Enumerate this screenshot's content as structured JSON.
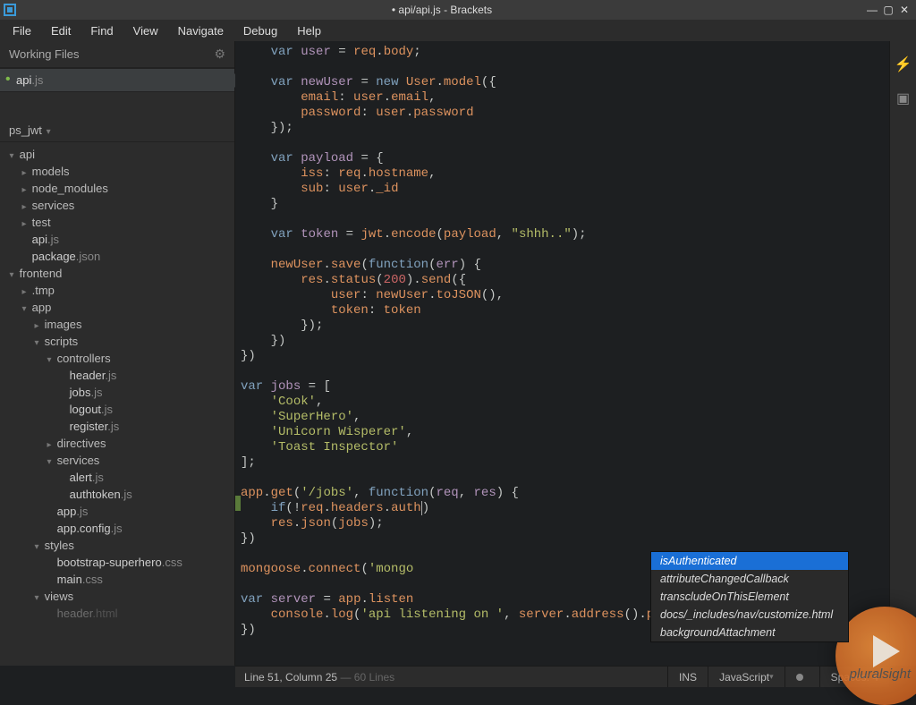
{
  "window": {
    "title": "• api/api.js - Brackets",
    "app_name": "Brackets"
  },
  "menu": [
    "File",
    "Edit",
    "Find",
    "View",
    "Navigate",
    "Debug",
    "Help"
  ],
  "sidebar": {
    "working_files_label": "Working Files",
    "working_files": [
      {
        "name": "api",
        "ext": ".js",
        "dirty": true,
        "active": true
      }
    ],
    "project_root": "ps_jwt",
    "tree": [
      {
        "type": "folder",
        "name": "api",
        "depth": 0,
        "open": true,
        "collapsed": false
      },
      {
        "type": "folder",
        "name": "models",
        "depth": 1,
        "open": false
      },
      {
        "type": "folder",
        "name": "node_modules",
        "depth": 1,
        "open": false
      },
      {
        "type": "folder",
        "name": "services",
        "depth": 1,
        "open": false
      },
      {
        "type": "folder",
        "name": "test",
        "depth": 1,
        "open": false
      },
      {
        "type": "file",
        "name": "api",
        "ext": ".js",
        "depth": 1
      },
      {
        "type": "file",
        "name": "package",
        "ext": ".json",
        "depth": 1
      },
      {
        "type": "folder",
        "name": "frontend",
        "depth": 0,
        "open": true,
        "collapsed": false
      },
      {
        "type": "folder",
        "name": ".tmp",
        "depth": 1,
        "open": false
      },
      {
        "type": "folder",
        "name": "app",
        "depth": 1,
        "open": true,
        "collapsed": false
      },
      {
        "type": "folder",
        "name": "images",
        "depth": 2,
        "open": false
      },
      {
        "type": "folder",
        "name": "scripts",
        "depth": 2,
        "open": true,
        "collapsed": false
      },
      {
        "type": "folder",
        "name": "controllers",
        "depth": 3,
        "open": true,
        "collapsed": false
      },
      {
        "type": "file",
        "name": "header",
        "ext": ".js",
        "depth": 4
      },
      {
        "type": "file",
        "name": "jobs",
        "ext": ".js",
        "depth": 4
      },
      {
        "type": "file",
        "name": "logout",
        "ext": ".js",
        "depth": 4
      },
      {
        "type": "file",
        "name": "register",
        "ext": ".js",
        "depth": 4
      },
      {
        "type": "folder",
        "name": "directives",
        "depth": 3,
        "open": false
      },
      {
        "type": "folder",
        "name": "services",
        "depth": 3,
        "open": true,
        "collapsed": false
      },
      {
        "type": "file",
        "name": "alert",
        "ext": ".js",
        "depth": 4
      },
      {
        "type": "file",
        "name": "authtoken",
        "ext": ".js",
        "depth": 4
      },
      {
        "type": "file",
        "name": "app",
        "ext": ".js",
        "depth": 3
      },
      {
        "type": "file",
        "name": "app.config",
        "ext": ".js",
        "depth": 3
      },
      {
        "type": "folder",
        "name": "styles",
        "depth": 2,
        "open": true,
        "collapsed": false
      },
      {
        "type": "file",
        "name": "bootstrap-superhero",
        "ext": ".css",
        "depth": 3
      },
      {
        "type": "file",
        "name": "main",
        "ext": ".css",
        "depth": 3
      },
      {
        "type": "folder",
        "name": "views",
        "depth": 2,
        "open": true,
        "collapsed": false
      },
      {
        "type": "file",
        "name": "header",
        "ext": ".html",
        "depth": 3,
        "cutoff": true
      }
    ]
  },
  "editor": {
    "filename": "api/api.js",
    "cursor": {
      "line": 51,
      "column": 25,
      "total_lines": 60
    },
    "active_edit_line": 31
  },
  "autocomplete": {
    "items": [
      "isAuthenticated",
      "attributeChangedCallback",
      "transcludeOnThisElement",
      "docs/_includes/nav/customize.html",
      "backgroundAttachment"
    ],
    "selected_index": 0
  },
  "status": {
    "position_prefix": "Line ",
    "position_mid": ", Column ",
    "lines_suffix": " Lines",
    "ins": "INS",
    "language": "JavaScript",
    "spaces_label": "Spaces: 4"
  },
  "rail_icons": [
    "bolt",
    "block"
  ],
  "watermark": {
    "brand": "pluralsight"
  }
}
